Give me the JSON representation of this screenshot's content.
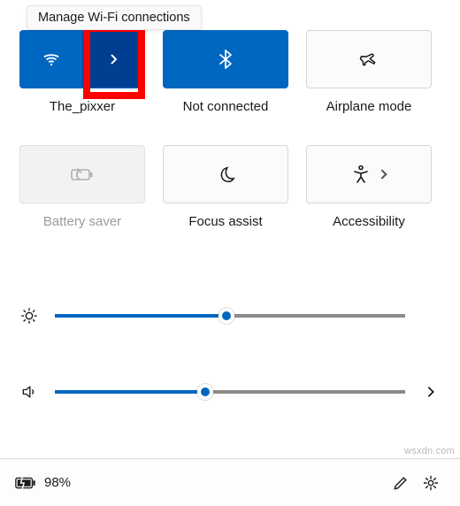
{
  "tooltip": "Manage Wi-Fi connections",
  "tiles": {
    "wifi": {
      "label": "The_pixxer"
    },
    "bluetooth": {
      "label": "Not connected"
    },
    "airplane": {
      "label": "Airplane mode"
    },
    "battery": {
      "label": "Battery saver"
    },
    "focus": {
      "label": "Focus assist"
    },
    "access": {
      "label": "Accessibility"
    }
  },
  "sliders": {
    "brightness": {
      "value": 49
    },
    "volume": {
      "value": 43
    }
  },
  "status": {
    "battery_percent": "98%"
  },
  "colors": {
    "accent": "#0067c0",
    "accent_deep": "#003e92",
    "highlight": "#ff0000"
  },
  "watermark": "wsxdn.com"
}
